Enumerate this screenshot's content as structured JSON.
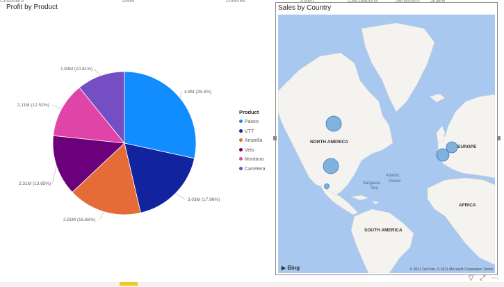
{
  "ribbon": {
    "tabs": [
      "Clipboard",
      "Data",
      "Queries",
      "Insert",
      "Calculations",
      "Sensitivity",
      "Share"
    ]
  },
  "pie": {
    "title": "Profit by Product",
    "legend_title": "Product",
    "chart_data": {
      "type": "pie",
      "slices": [
        {
          "name": "Paseo",
          "value": 4.8,
          "label": "4.8M (28.4%)",
          "color": "#118dff"
        },
        {
          "name": "VTT",
          "value": 3.03,
          "label": "3.03M (17.96%)",
          "color": "#12239e"
        },
        {
          "name": "Amarilla",
          "value": 2.81,
          "label": "2.81M (16.66%)",
          "color": "#e66c37"
        },
        {
          "name": "Velo",
          "value": 2.31,
          "label": "2.31M (13.65%)",
          "color": "#6b007b"
        },
        {
          "name": "Montana",
          "value": 2.11,
          "label": "2.11M (12.52%)",
          "color": "#e044a7"
        },
        {
          "name": "Carretera",
          "value": 1.83,
          "label": "1.83M (10.81%)",
          "color": "#744ec2"
        }
      ]
    }
  },
  "map": {
    "title": "Sales by Country",
    "labels": {
      "north_america": "NORTH AMERICA",
      "europe": "EUROPE",
      "africa": "AFRICA",
      "south_america": "SOUTH AMERICA",
      "atlantic": "Atlantic",
      "ocean": "Ocean",
      "sargasso": "Sargasso",
      "sea": "Sea"
    },
    "attribution": "© 2021 TomTom, © 2021 Microsoft Corporation Terms",
    "logo": "Bing",
    "bubble_color": "#5b9bd5"
  },
  "footer_icons": [
    "filter-icon",
    "focus-mode-icon",
    "more-options-icon"
  ]
}
